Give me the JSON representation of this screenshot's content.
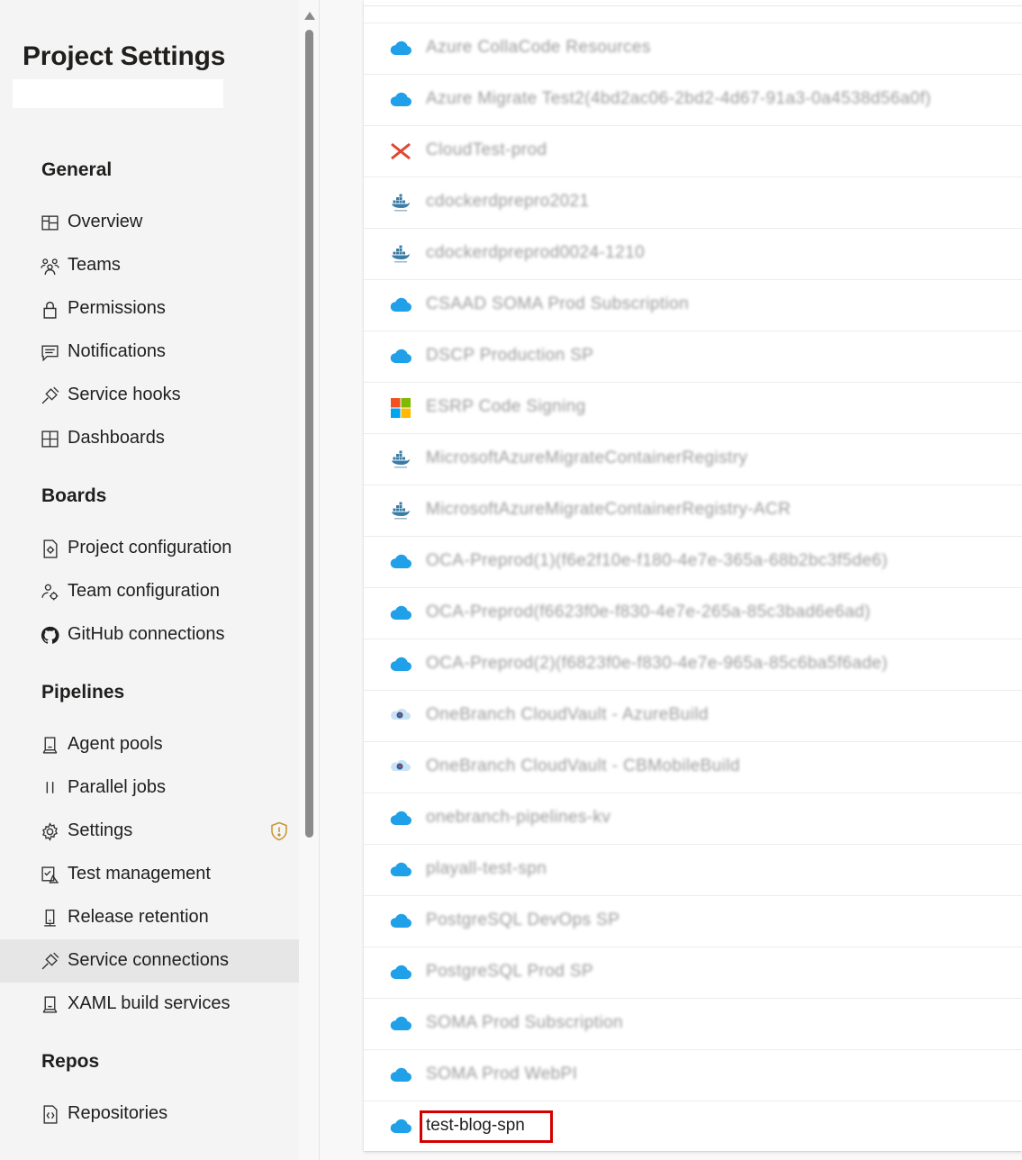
{
  "sidebar": {
    "title": "Project Settings",
    "sections": {
      "general": {
        "title": "General",
        "items": [
          {
            "label": "Overview",
            "icon": "overview-icon"
          },
          {
            "label": "Teams",
            "icon": "teams-icon"
          },
          {
            "label": "Permissions",
            "icon": "lock-icon"
          },
          {
            "label": "Notifications",
            "icon": "chat-icon"
          },
          {
            "label": "Service hooks",
            "icon": "plug-icon"
          },
          {
            "label": "Dashboards",
            "icon": "grid-icon"
          }
        ]
      },
      "boards": {
        "title": "Boards",
        "items": [
          {
            "label": "Project configuration",
            "icon": "gear-doc-icon"
          },
          {
            "label": "Team configuration",
            "icon": "team-gear-icon"
          },
          {
            "label": "GitHub connections",
            "icon": "github-icon"
          }
        ]
      },
      "pipelines": {
        "title": "Pipelines",
        "items": [
          {
            "label": "Agent pools",
            "icon": "agent-icon"
          },
          {
            "label": "Parallel jobs",
            "icon": "parallel-icon"
          },
          {
            "label": "Settings",
            "icon": "gear-icon"
          },
          {
            "label": "Test management",
            "icon": "test-icon"
          },
          {
            "label": "Release retention",
            "icon": "phone-icon"
          },
          {
            "label": "Service connections",
            "icon": "plug-icon",
            "selected": true
          },
          {
            "label": "XAML build services",
            "icon": "agent-icon"
          }
        ]
      },
      "repos": {
        "title": "Repos",
        "items": [
          {
            "label": "Repositories",
            "icon": "repo-icon"
          }
        ]
      }
    }
  },
  "colors": {
    "azure_cloud": "#1fa0e8",
    "highlight": "#d40000",
    "selected_bg": "#e6e6e6",
    "warning": "#c8922c"
  },
  "connections": [
    {
      "name": "Azure CollaCode Resources",
      "icon": "azure-cloud-icon"
    },
    {
      "name": "Azure Migrate Test2(4bd2ac06-2bd2-4d67-91a3-0a4538d56a0f)",
      "icon": "azure-cloud-icon"
    },
    {
      "name": "CloudTest-prod",
      "icon": "cloudtest-icon"
    },
    {
      "name": "cdockerdprepro2021",
      "icon": "docker-icon"
    },
    {
      "name": "cdockerdpreprod0024-1210",
      "icon": "docker-icon"
    },
    {
      "name": "CSAAD SOMA Prod Subscription",
      "icon": "azure-cloud-icon"
    },
    {
      "name": "DSCP Production SP",
      "icon": "azure-cloud-icon"
    },
    {
      "name": "ESRP Code Signing",
      "icon": "microsoft-icon"
    },
    {
      "name": "MicrosoftAzureMigrateContainerRegistry",
      "icon": "docker-icon"
    },
    {
      "name": "MicrosoftAzureMigrateContainerRegistry-ACR",
      "icon": "docker-icon"
    },
    {
      "name": "OCA-Preprod(1)(f6e2f10e-f180-4e7e-365a-68b2bc3f5de6)",
      "icon": "azure-cloud-icon"
    },
    {
      "name": "OCA-Preprod(f6623f0e-f830-4e7e-265a-85c3bad6e6ad)",
      "icon": "azure-cloud-icon"
    },
    {
      "name": "OCA-Preprod(2)(f6823f0e-f830-4e7e-965a-85c6ba5f6ade)",
      "icon": "azure-cloud-icon"
    },
    {
      "name": "OneBranch CloudVault - AzureBuild",
      "icon": "cloudvault-icon"
    },
    {
      "name": "OneBranch CloudVault - CBMobileBuild",
      "icon": "cloudvault-icon"
    },
    {
      "name": "onebranch-pipelines-kv",
      "icon": "azure-cloud-icon"
    },
    {
      "name": "playall-test-spn",
      "icon": "azure-cloud-icon"
    },
    {
      "name": "PostgreSQL DevOps SP",
      "icon": "azure-cloud-icon"
    },
    {
      "name": "PostgreSQL Prod SP",
      "icon": "azure-cloud-icon"
    },
    {
      "name": "SOMA Prod Subscription",
      "icon": "azure-cloud-icon"
    },
    {
      "name": "SOMA Prod WebPI",
      "icon": "azure-cloud-icon"
    },
    {
      "name": "test-blog-spn",
      "icon": "azure-cloud-icon",
      "highlighted": true
    }
  ]
}
